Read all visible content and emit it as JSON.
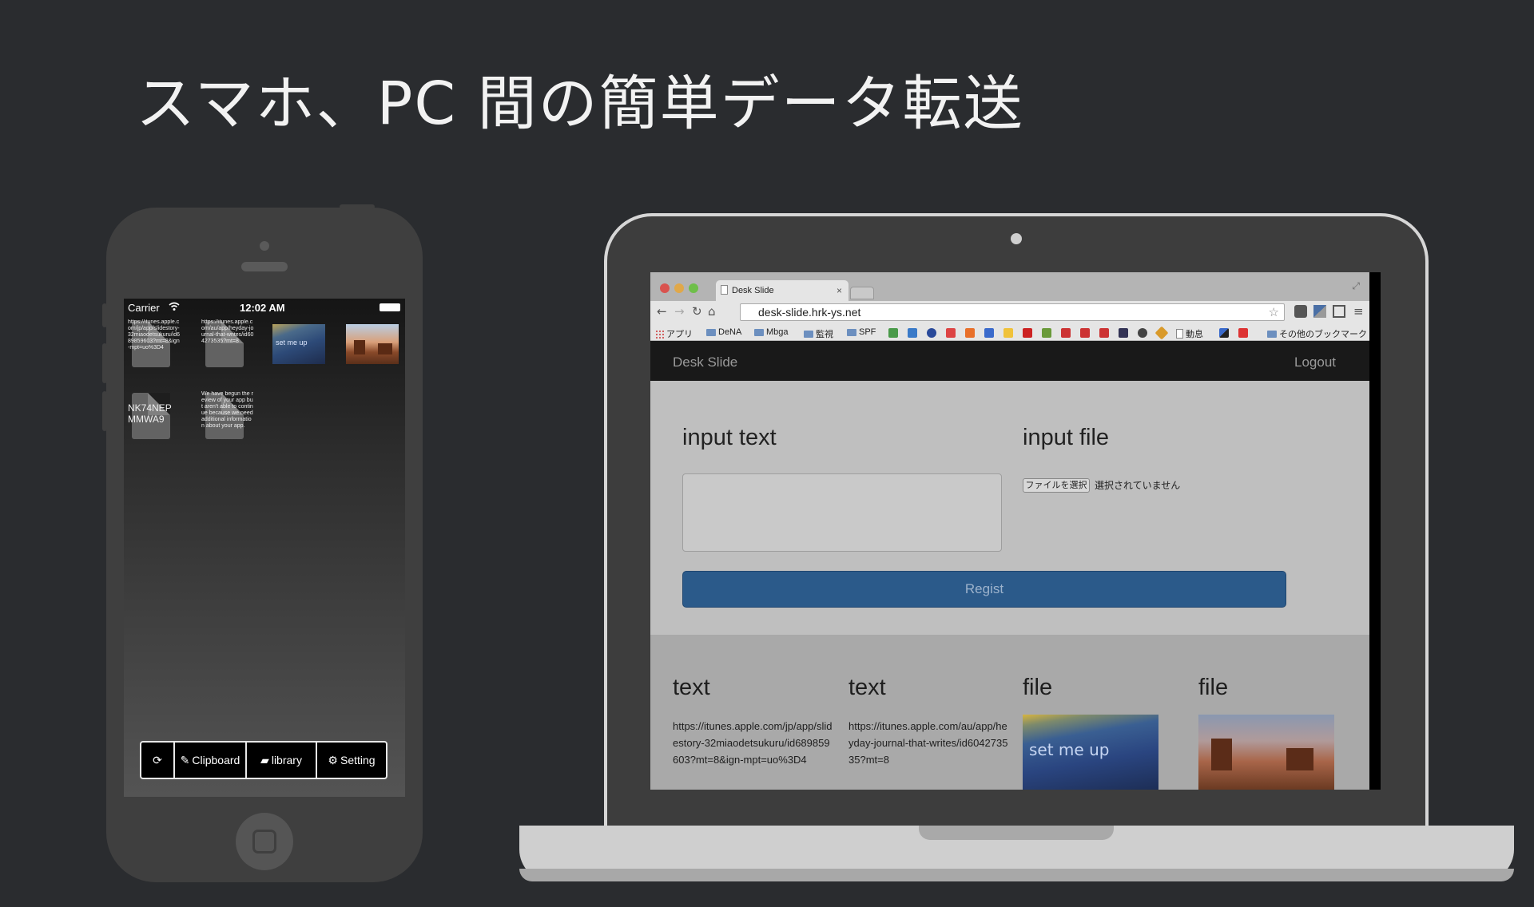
{
  "slide": {
    "title": "スマホ、PC 間の簡単データ転送"
  },
  "phone": {
    "status": {
      "carrier": "Carrier",
      "time": "12:02 AM"
    },
    "items": [
      {
        "type": "text",
        "text": "https://itunes.apple.com/jp/app/slidestory-32miaodetsukuru/id689859603?mt=8&ign-mpt=uo%3D4"
      },
      {
        "type": "text",
        "text": "https://itunes.apple.com/au/app/heyday-journal-that-writes/id604273535?mt=8"
      },
      {
        "type": "image",
        "label": "set me up"
      },
      {
        "type": "image",
        "label": ""
      },
      {
        "type": "text",
        "text": "NK74NEP MMWA9"
      },
      {
        "type": "text",
        "text": "We have begun the review of your app but aren't able to continue because we need additional information about your app."
      }
    ],
    "tabs": [
      {
        "icon": "refresh-icon",
        "label": ""
      },
      {
        "icon": "paperclip-icon",
        "label": "Clipboard"
      },
      {
        "icon": "folder-icon",
        "label": "library"
      },
      {
        "icon": "gear-icon",
        "label": "Setting"
      }
    ]
  },
  "browser": {
    "tab_title": "Desk Slide",
    "url": "desk-slide.hrk-ys.net",
    "bookmarks": [
      "アプリ",
      "DeNA",
      "Mbga",
      "監視",
      "SPF",
      "動息",
      "その他のブックマーク"
    ]
  },
  "app": {
    "brand": "Desk Slide",
    "logout": "Logout",
    "form": {
      "text_label": "input text",
      "file_label": "input file",
      "file_button": "ファイルを選択",
      "file_status": "選択されていません",
      "submit": "Regist"
    },
    "entries": [
      {
        "kind": "text",
        "content": "https://itunes.apple.com/jp/app/slidestory-32miaodetsukuru/id689859603?mt=8&ign-mpt=uo%3D4"
      },
      {
        "kind": "text",
        "content": "https://itunes.apple.com/au/app/heyday-journal-that-writes/id604273535?mt=8"
      },
      {
        "kind": "file",
        "content": "set me up"
      },
      {
        "kind": "file",
        "content": ""
      }
    ]
  },
  "colors": {
    "background": "#2a2c2f",
    "regist_button": "#2b5a8a",
    "device": "#3f3f3f"
  }
}
